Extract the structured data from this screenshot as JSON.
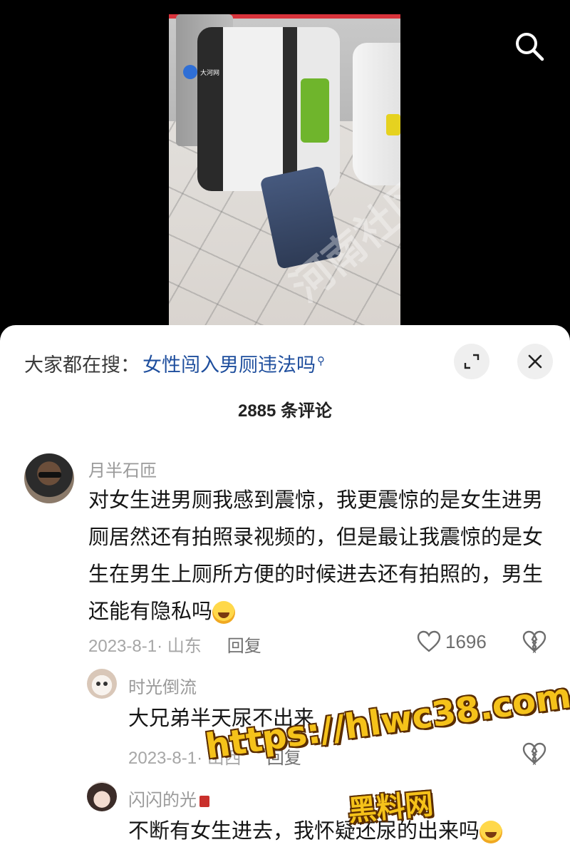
{
  "video": {
    "news_logo_text": "大河网",
    "watermark_text": "河南社区"
  },
  "search": {
    "prefix": "大家都在搜：",
    "query": "女性闯入男厕违法吗"
  },
  "comments_count_label": "2885 条评论",
  "comments": [
    {
      "username": "月半石匝",
      "text": "对女生进男厕我感到震惊，我更震惊的是女生进男厕居然还有拍照录视频的，但是最让我震惊的是女生在男生上厕所方便的时候进去还有拍照的，男生还能有隐私吗",
      "date_location": "2023-8-1· 山东",
      "reply_label": "回复",
      "likes": "1696",
      "replies": [
        {
          "username": "时光倒流",
          "text": "大兄弟半天尿不出来",
          "date_location": "2023-8-1· 山西",
          "reply_label": "回复"
        },
        {
          "username": "闪闪的光",
          "text": "不断有女生进去，我怀疑还尿的出来吗"
        }
      ]
    }
  ],
  "overlay": {
    "url": "https://hlwc38.com",
    "name": "黑料网"
  },
  "colors": {
    "link_blue": "#1e4e9d",
    "watermark_gold": "#f5c21a"
  }
}
